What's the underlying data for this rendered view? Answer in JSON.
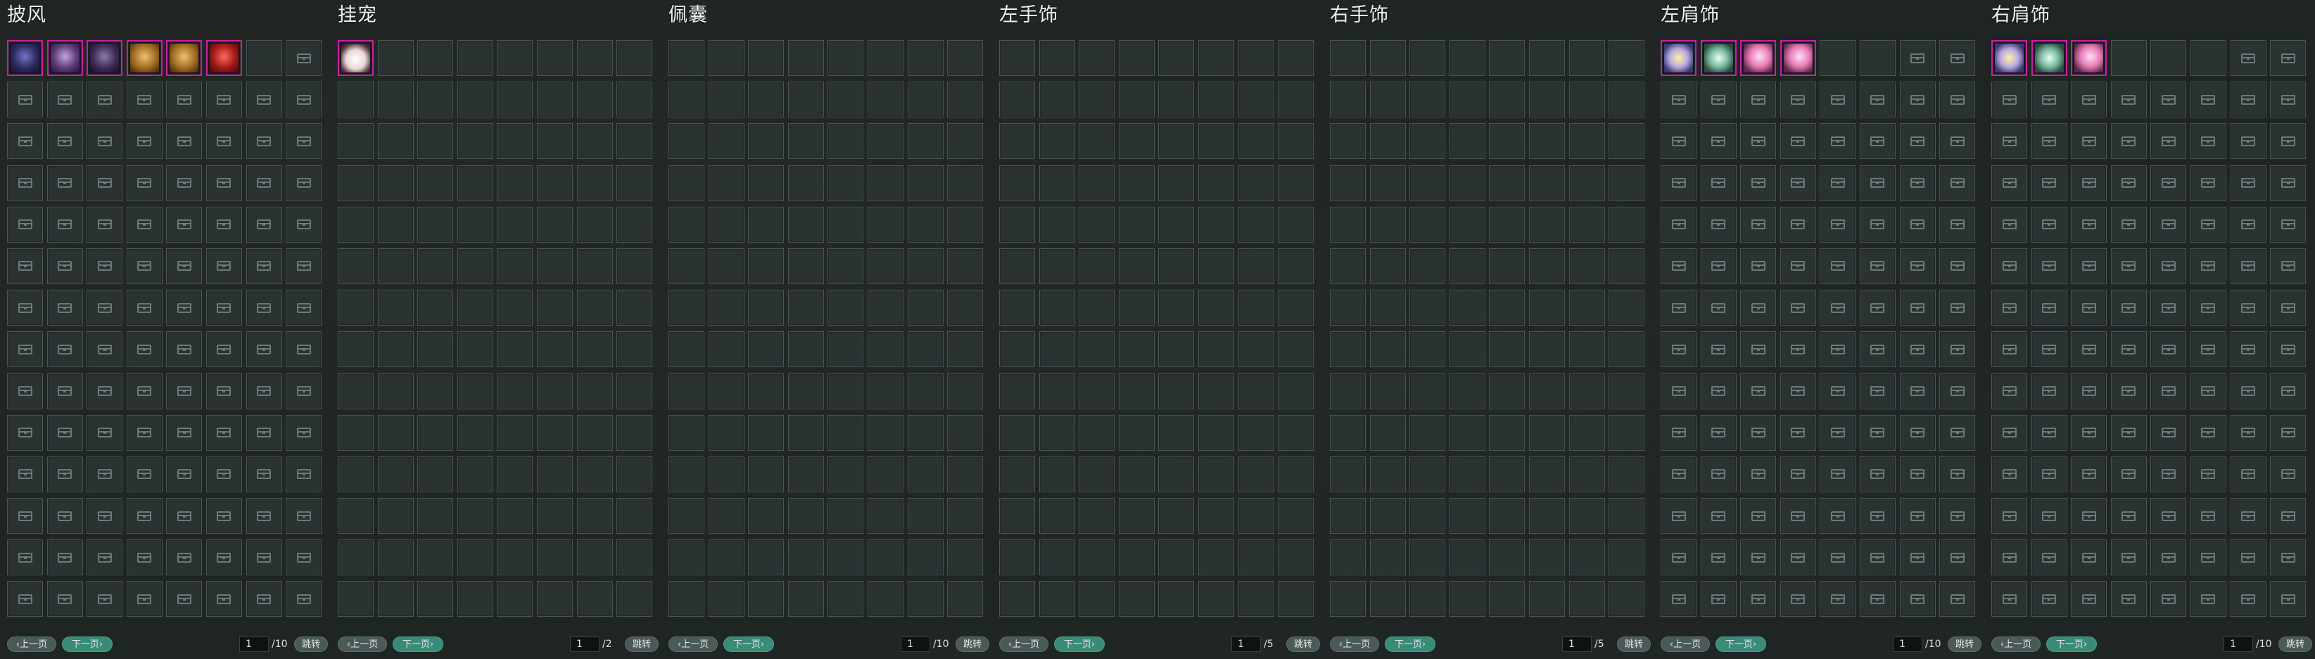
{
  "panels": [
    {
      "title": "披风",
      "items": [
        "art-cloak-blue",
        "art-cloak-purple",
        "art-cloak-dark",
        "art-cloak-gold",
        "art-cloak-gold",
        "art-cloak-red"
      ],
      "show_chest": true,
      "first_row_empty_count": 1,
      "page_current": "1",
      "page_total": "/10"
    },
    {
      "title": "挂宠",
      "items": [
        "art-pet"
      ],
      "show_chest": false,
      "first_row_empty_count": 0,
      "page_current": "1",
      "page_total": "/2"
    },
    {
      "title": "佩囊",
      "items": [],
      "show_chest": false,
      "first_row_empty_count": 0,
      "page_current": "1",
      "page_total": "/10"
    },
    {
      "title": "左手饰",
      "items": [],
      "show_chest": false,
      "first_row_empty_count": 0,
      "page_current": "1",
      "page_total": "/5"
    },
    {
      "title": "右手饰",
      "items": [],
      "show_chest": false,
      "first_row_empty_count": 0,
      "page_current": "1",
      "page_total": "/5"
    },
    {
      "title": "左肩饰",
      "items": [
        "art-wing-yellow",
        "art-wing-green",
        "art-scepter",
        "art-scepter"
      ],
      "show_chest": true,
      "first_row_empty_count": 2,
      "page_current": "1",
      "page_total": "/10"
    },
    {
      "title": "右肩饰",
      "items": [
        "art-wing-yellow",
        "art-wing-green",
        "art-scepter"
      ],
      "show_chest": true,
      "first_row_empty_count": 3,
      "page_current": "1",
      "page_total": "/10"
    }
  ],
  "labels": {
    "prev": "‹上一页",
    "next": "下一页›",
    "jump": "跳转"
  },
  "grid": {
    "rows": 14,
    "cols": 8
  },
  "colors": {
    "item_border": "#c81fa3",
    "next_button": "#3a8a7a",
    "slot_border": "#4b5654"
  },
  "icons": {
    "empty_slot": "chest-icon"
  }
}
